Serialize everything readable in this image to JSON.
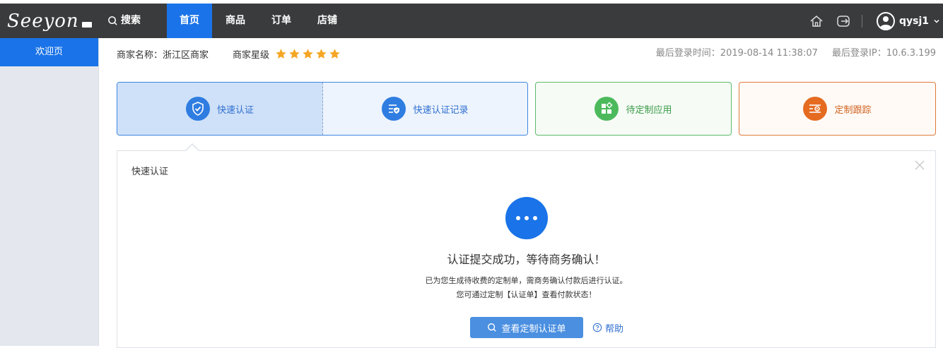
{
  "header": {
    "logo_text": "Seeyon",
    "search_label": "搜索",
    "nav": [
      {
        "label": "首页",
        "active": true
      },
      {
        "label": "商品"
      },
      {
        "label": "订单"
      },
      {
        "label": "店铺"
      }
    ],
    "username": "qysj1",
    "icons": [
      "search-icon",
      "home-icon",
      "logout-icon",
      "avatar-icon",
      "chevron-down-icon"
    ]
  },
  "sidebar": {
    "items": [
      {
        "label": "欢迎页",
        "active": true
      }
    ]
  },
  "merchant": {
    "name_label": "商家名称：",
    "name": "浙江区商家",
    "rating_label": "商家星级",
    "stars": 5
  },
  "login": {
    "time_label": "最后登录时间：",
    "time": "2019-08-14 11:38:07",
    "ip_label": "最后登录IP：",
    "ip": "10.6.3.199"
  },
  "cards": [
    {
      "label": "快速认证",
      "icon": "shield-check-icon",
      "color": "#2f7de1"
    },
    {
      "label": "快速认证记录",
      "icon": "record-list-icon",
      "color": "#2f7de1"
    },
    {
      "label": "待定制应用",
      "icon": "apps-icon",
      "color": "#4cba5c"
    },
    {
      "label": "定制跟踪",
      "icon": "tracking-icon",
      "color": "#e56b21"
    }
  ],
  "panel": {
    "title": "快速认证",
    "message_title": "认证提交成功，等待商务确认！",
    "message_line1": "已为您生成待收费的定制单，需商务确认付款后进行认证。",
    "message_line2": "您可通过定制【认证单】查看付款状态！",
    "view_button": "查看定制认证单",
    "help_label": "帮助"
  },
  "colors": {
    "topbar": "#3a3b3d",
    "accent": "#1a73e8",
    "star": "#f5a623"
  }
}
